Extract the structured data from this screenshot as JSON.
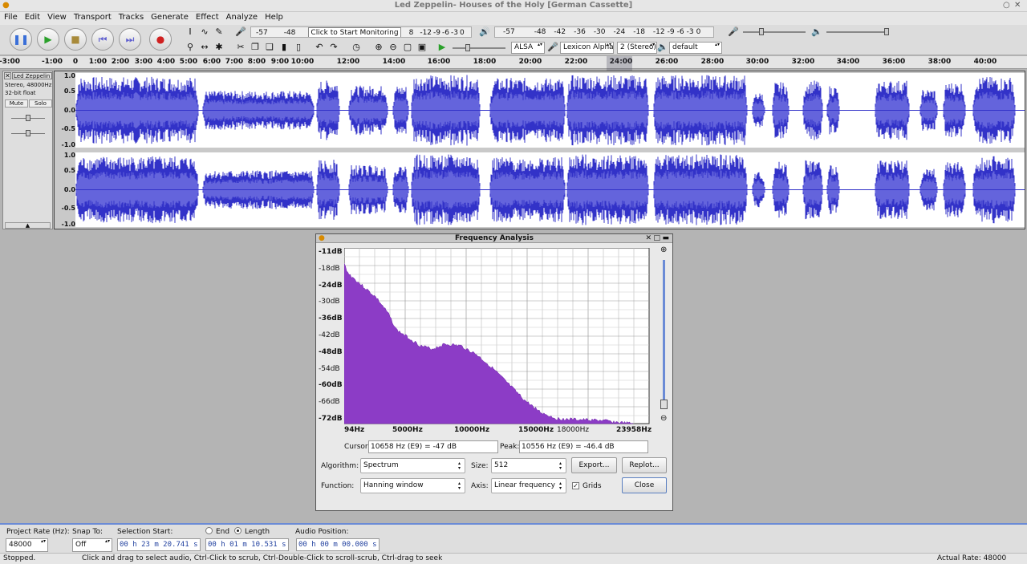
{
  "window": {
    "title": "Led Zeppelin- Houses of the Holy [German Cassette]"
  },
  "menu": [
    "File",
    "Edit",
    "View",
    "Transport",
    "Tracks",
    "Generate",
    "Effect",
    "Analyze",
    "Help"
  ],
  "meters": {
    "record_ticks": [
      "-57",
      "-48"
    ],
    "record_prompt": "Click to Start Monitoring",
    "record_ticks_right": [
      "8",
      "-12",
      "-9",
      "-6",
      "-3",
      "0"
    ],
    "play_ticks": [
      "-57",
      "-48",
      "-42",
      "-36",
      "-30",
      "-24",
      "-18",
      "-12",
      "-9",
      "-6",
      "-3",
      "0"
    ]
  },
  "device": {
    "host": "ALSA",
    "recording_device": "Lexicon Alpha",
    "channels": "2 (Stereo)",
    "playback_device": "default"
  },
  "ruler": {
    "ticks": [
      "-3:00",
      "-1:00",
      "0",
      "1:00",
      "2:00",
      "3:00",
      "4:00",
      "5:00",
      "6:00",
      "7:00",
      "8:00",
      "9:00",
      "10:00",
      "12:00",
      "14:00",
      "16:00",
      "18:00",
      "20:00",
      "22:00",
      "24:00",
      "26:00",
      "28:00",
      "30:00",
      "32:00",
      "34:00",
      "36:00",
      "38:00",
      "40:00"
    ]
  },
  "track": {
    "name": "Led Zeppelin",
    "info1": "Stereo, 48000Hz",
    "info2": "32-bit float",
    "mute": "Mute",
    "solo": "Solo",
    "scale": [
      "1.0",
      "0.5",
      "0.0",
      "-0.5",
      "-1.0"
    ]
  },
  "dialog": {
    "title": "Frequency Analysis",
    "db_labels": [
      "-11dB",
      "-18dB",
      "-24dB",
      "-30dB",
      "-36dB",
      "-42dB",
      "-48dB",
      "-54dB",
      "-60dB",
      "-66dB",
      "-72dB"
    ],
    "freq_labels": [
      "94Hz",
      "5000Hz",
      "10000Hz",
      "15000Hz",
      "18000Hz",
      "23958Hz"
    ],
    "cursor_label": "Cursor:",
    "cursor_value": "10658 Hz (E9) = -47 dB",
    "peak_label": "Peak:",
    "peak_value": "10556 Hz (E9) = -46.4 dB",
    "algorithm_label": "Algorithm:",
    "algorithm": "Spectrum",
    "size_label": "Size:",
    "size": "512",
    "function_label": "Function:",
    "function": "Hanning window",
    "axis_label": "Axis:",
    "axis": "Linear frequency",
    "grids_label": "Grids",
    "export": "Export...",
    "replot": "Replot...",
    "close": "Close",
    "spectrum_color": "#8c3cc6"
  },
  "selection": {
    "rate_label": "Project Rate (Hz):",
    "rate": "48000",
    "snap_label": "Snap To:",
    "snap": "Off",
    "start_label": "Selection Start:",
    "start": "00 h 23 m 20.741 s",
    "end_label": "End",
    "length_label": "Length",
    "length": "00 h 01 m 10.531 s",
    "audio_pos_label": "Audio Position:",
    "audio_pos": "00 h 00 m 00.000 s"
  },
  "status": {
    "state": "Stopped.",
    "hint": "Click and drag to select audio, Ctrl-Click to scrub, Ctrl-Double-Click to scroll-scrub, Ctrl-drag to seek",
    "rate": "Actual Rate: 48000"
  },
  "colors": {
    "wave": "#3232c8",
    "wave_rms": "#6464dc"
  }
}
